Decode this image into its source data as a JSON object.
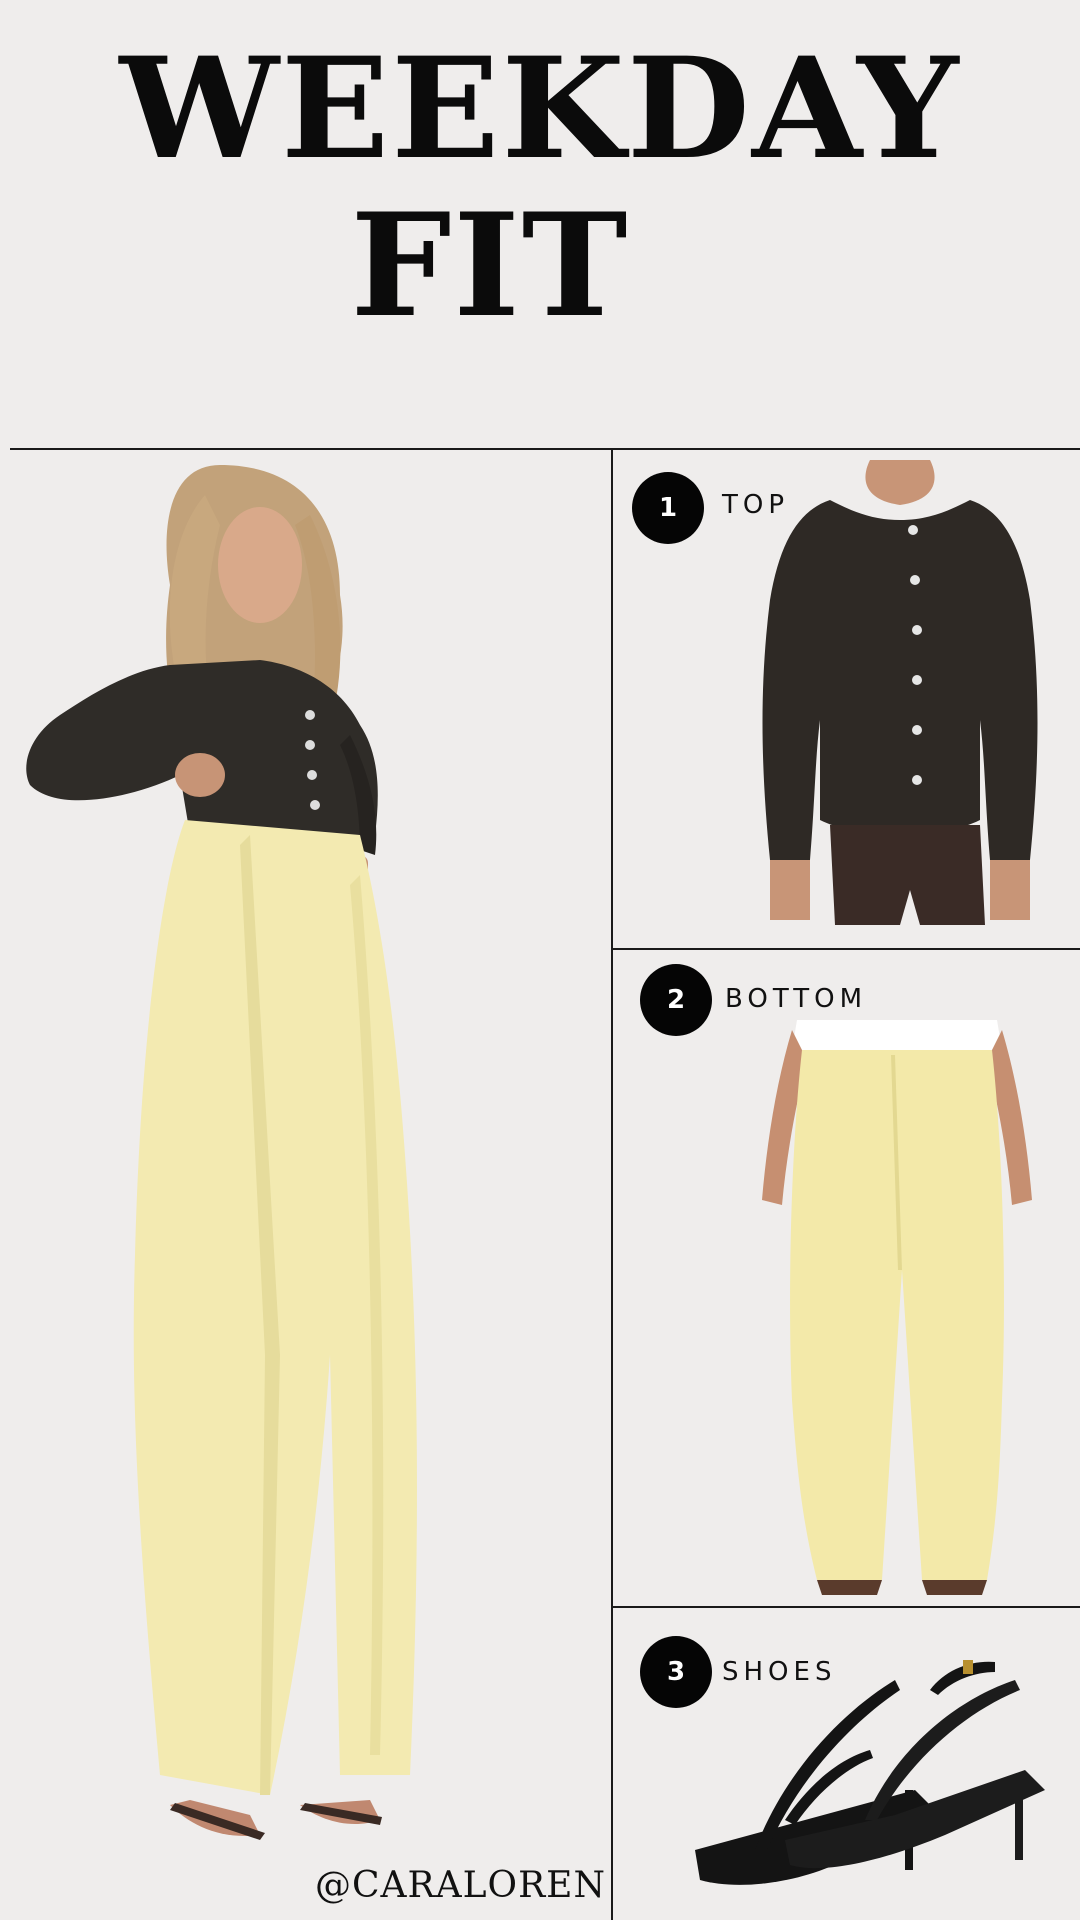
{
  "header": {
    "title_line1": "WEEKDAY",
    "title_line2": "FIT"
  },
  "items": [
    {
      "number": "1",
      "label": "TOP"
    },
    {
      "number": "2",
      "label": "BOTTOM"
    },
    {
      "number": "3",
      "label": "SHOES"
    }
  ],
  "footer": {
    "handle": "@CARALOREN"
  },
  "colors": {
    "background": "#efedec",
    "cardigan": "#2f2c28",
    "trousers": "#f3eab1",
    "hair": "#c2a27a",
    "sandal": "#141414"
  }
}
